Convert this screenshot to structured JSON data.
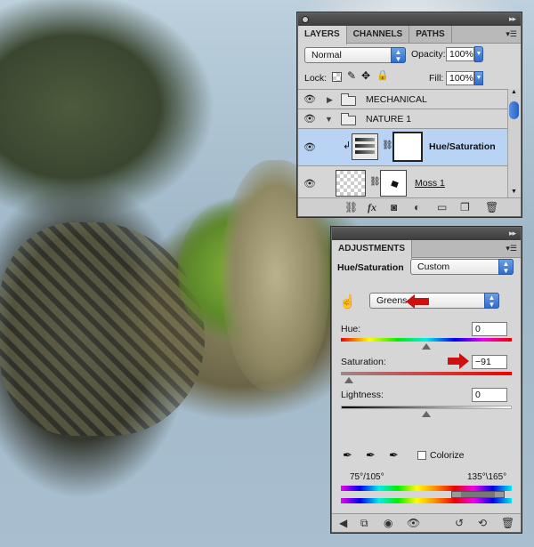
{
  "layers_panel": {
    "tabs": [
      "LAYERS",
      "CHANNELS",
      "PATHS"
    ],
    "blend_mode": "Normal",
    "opacity_label": "Opacity:",
    "opacity_value": "100%",
    "lock_label": "Lock:",
    "fill_label": "Fill:",
    "fill_value": "100%",
    "layers": [
      {
        "name": "MECHANICAL",
        "type": "group",
        "expanded": false
      },
      {
        "name": "NATURE 1",
        "type": "group",
        "expanded": true
      },
      {
        "name": "Hue/Saturation",
        "type": "adjustment",
        "selected": true
      },
      {
        "name": "Moss 1",
        "type": "layer"
      }
    ]
  },
  "adjustments_panel": {
    "tab": "ADJUSTMENTS",
    "title": "Hue/Saturation",
    "preset": "Custom",
    "range": "Greens",
    "hue_label": "Hue:",
    "hue_value": "0",
    "saturation_label": "Saturation:",
    "saturation_value": "−91",
    "lightness_label": "Lightness:",
    "lightness_value": "0",
    "colorize_label": "Colorize",
    "range_left": "75°/105°",
    "range_right": "135°\\165°",
    "hue_level": 0.5,
    "saturation_level": 0.045,
    "lightness_level": 0.5
  },
  "colors": {
    "selected_row": "#b8d3f3",
    "accent_blue": "#2d6cd0",
    "marker_red": "#cc1111"
  }
}
